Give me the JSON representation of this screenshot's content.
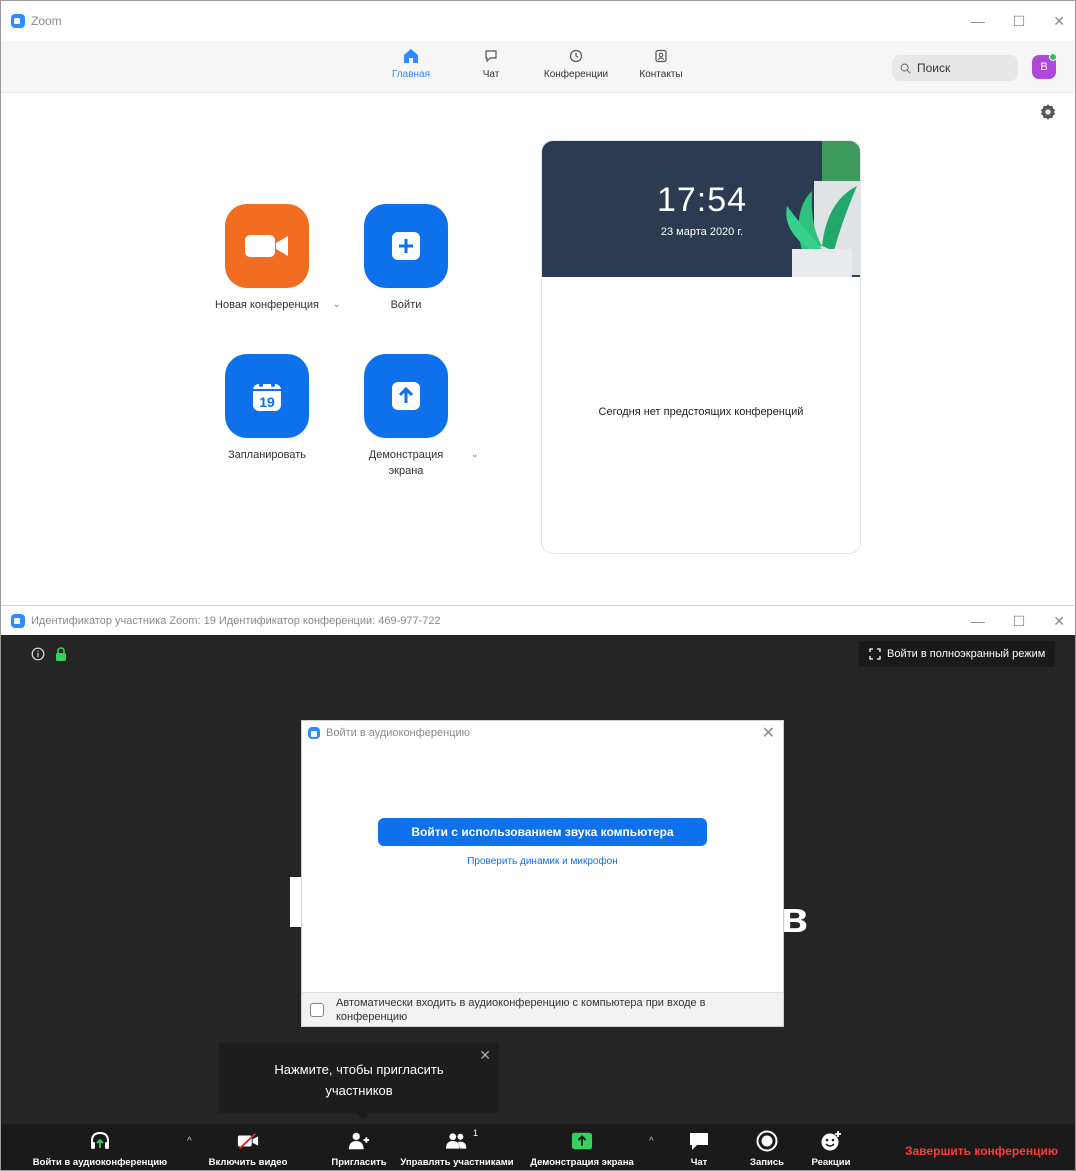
{
  "home_window": {
    "title": "Zoom",
    "nav": {
      "home": "Главная",
      "chat": "Чат",
      "meetings": "Конференции",
      "contacts": "Контакты"
    },
    "search_placeholder": "Поиск",
    "avatar_letter": "В",
    "actions": {
      "new_meeting": "Новая конференция",
      "join": "Войти",
      "schedule": "Запланировать",
      "schedule_day": "19",
      "share_screen": "Демонстрация экрана"
    },
    "card": {
      "time": "17:54",
      "date": "23 марта 2020 г.",
      "no_meetings": "Сегодня нет предстоящих конференций"
    }
  },
  "meeting_window": {
    "title": "Идентификатор участника Zoom: 19   Идентификатор конференции: 469-977-722",
    "fullscreen": "Войти в полноэкранный режим",
    "audio_dialog": {
      "title": "Войти в аудиоконференцию",
      "join_computer_audio": "Войти с использованием звука компьютера",
      "test_link": "Проверить динамик и микрофон",
      "auto_join": "Автоматически входить в аудиоконференцию с компьютера при входе в конференцию"
    },
    "tooltip": "Нажмите, чтобы пригласить участников",
    "toolbar": {
      "join_audio": "Войти в аудиоконференцию",
      "start_video": "Включить видео",
      "invite": "Пригласить",
      "manage_participants": "Управлять участниками",
      "participants_count": "1",
      "share_screen": "Демонстрация экрана",
      "chat": "Чат",
      "record": "Запись",
      "reactions": "Реакции",
      "end_meeting": "Завершить конференцию"
    }
  }
}
